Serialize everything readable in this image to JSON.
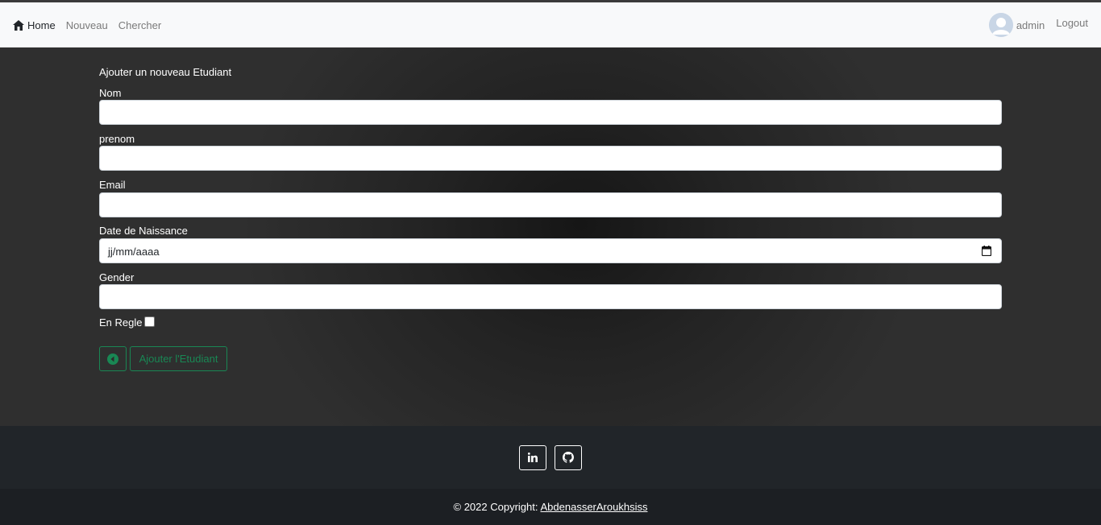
{
  "nav": {
    "home": "Home",
    "nouveau": "Nouveau",
    "chercher": "Chercher",
    "user": "admin",
    "logout": "Logout"
  },
  "form": {
    "title": "Ajouter un nouveau Etudiant",
    "nom_label": "Nom",
    "nom_value": "",
    "prenom_label": "prenom",
    "prenom_value": "",
    "email_label": "Email",
    "email_value": "",
    "date_label": "Date de Naissance",
    "date_placeholder": "jj/mm/aaaa",
    "gender_label": "Gender",
    "gender_value": "",
    "enregle_label": "En Regle",
    "enregle_checked": false,
    "submit_label": "Ajouter l'Etudiant"
  },
  "footer": {
    "copyright": "© 2022 Copyright:",
    "author": "AbdenasserAroukhsiss"
  },
  "colors": {
    "accent": "#198754",
    "navbar_bg": "#f8f9fa",
    "footer_bg": "#212529",
    "footer_copy_bg": "#1c1f23"
  },
  "icons": [
    "home-icon",
    "user-avatar-icon",
    "back-arrow-icon",
    "calendar-icon",
    "linkedin-icon",
    "github-icon"
  ]
}
